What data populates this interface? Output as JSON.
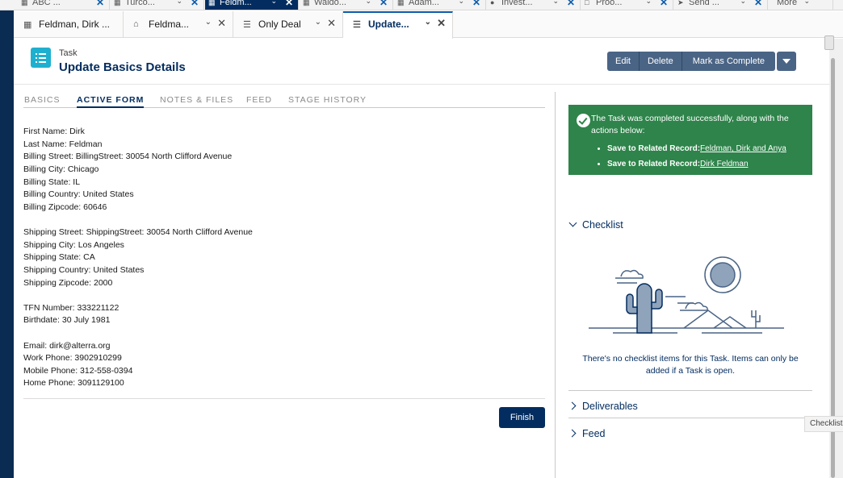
{
  "top_tabs": [
    {
      "label": "ABC ..."
    },
    {
      "label": "Turco..."
    },
    {
      "label": "Feldm..."
    },
    {
      "label": "Waldo..."
    },
    {
      "label": "Adam..."
    },
    {
      "label": "Invest..."
    },
    {
      "label": "Proo..."
    },
    {
      "label": "Send ..."
    },
    {
      "label": "More"
    }
  ],
  "sub_tabs": [
    {
      "label": "Feldman, Dirk ..."
    },
    {
      "label": "Feldma..."
    },
    {
      "label": "Only Deal"
    },
    {
      "label": "Update..."
    }
  ],
  "header": {
    "record_type": "Task",
    "title": "Update Basics Details",
    "buttons": {
      "edit": "Edit",
      "delete": "Delete",
      "mark_complete": "Mark as Complete"
    }
  },
  "record_tabs": [
    "BASICS",
    "ACTIVE FORM",
    "NOTES & FILES",
    "FEED",
    "STAGE HISTORY"
  ],
  "form_lines": [
    "First Name: Dirk",
    "Last Name: Feldman",
    "Billing Street: BillingStreet: 30054 North Clifford Avenue",
    "Billing City: Chicago",
    "Billing State: IL",
    "Billing Country: United States",
    "Billing Zipcode: 60646",
    "Shipping Street: ShippingStreet: 30054 North Clifford Avenue",
    "Shipping City: Los Angeles",
    "Shipping State: CA",
    "Shipping Country: United States",
    "Shipping Zipcode: 2000",
    "TFN Number: 333221122",
    "Birthdate: 30 July 1981",
    "Email: dirk@alterra.org",
    "Work Phone: 3902910299",
    "Mobile Phone: 312-558-0394",
    "Home Phone: 3091129100"
  ],
  "finish_label": "Finish",
  "success": {
    "message": "The Task was completed successfully, along with the actions below:",
    "items": [
      {
        "label": "Save to Related Record:",
        "link": "Feldman, Dirk and Anya"
      },
      {
        "label": "Save to Related Record:",
        "link": "Dirk Feldman"
      }
    ],
    "color": "#2e844a"
  },
  "checklist": {
    "title": "Checklist",
    "empty_message": "There's no checklist items for this Task. Items can only be added if a Task is open."
  },
  "deliverables_title": "Deliverables",
  "feed_title": "Feed",
  "tooltip": "Checklist",
  "colors": {
    "brand_dark": "#032d60",
    "button": "#4a6485",
    "icon_teal": "#1fb0cf"
  }
}
